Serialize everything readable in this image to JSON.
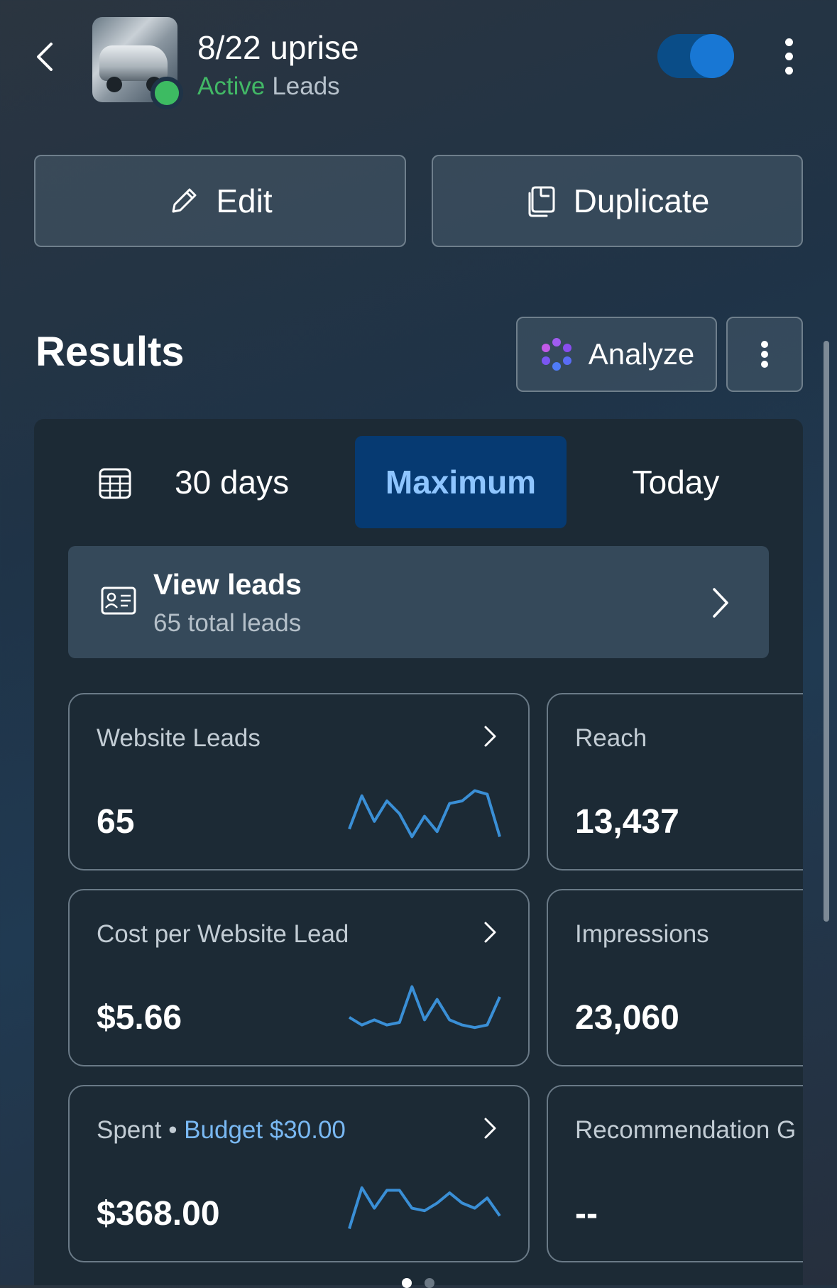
{
  "header": {
    "title": "8/22 uprise",
    "status": "Active",
    "objective": "Leads",
    "back_icon": "chevron-left-icon",
    "more_icon": "more-vertical-icon"
  },
  "actions": {
    "edit_label": "Edit",
    "duplicate_label": "Duplicate"
  },
  "results": {
    "heading": "Results",
    "analyze_label": "Analyze"
  },
  "date_tabs": {
    "tab_30": "30 days",
    "tab_max": "Maximum",
    "tab_today": "Today",
    "selected": "Maximum"
  },
  "view_leads": {
    "title": "View leads",
    "subtitle": "65 total leads"
  },
  "metrics": {
    "website_leads": {
      "label": "Website Leads",
      "value": "65",
      "trend": [
        0.2,
        0.85,
        0.35,
        0.75,
        0.5,
        0.05,
        0.45,
        0.15,
        0.7,
        0.75,
        0.95,
        0.88,
        0.05
      ]
    },
    "reach": {
      "label": "Reach",
      "value": "13,437"
    },
    "cost_per_lead": {
      "label": "Cost per Website Lead",
      "value": "$5.66",
      "trend": [
        0.35,
        0.2,
        0.3,
        0.2,
        0.25,
        0.95,
        0.3,
        0.7,
        0.3,
        0.2,
        0.15,
        0.2,
        0.75
      ]
    },
    "impressions": {
      "label": "Impressions",
      "value": "23,060"
    },
    "spent": {
      "label": "Spent",
      "budget_label": "Budget $30.00",
      "value": "$368.00",
      "trend": [
        0.05,
        0.85,
        0.45,
        0.8,
        0.8,
        0.45,
        0.4,
        0.55,
        0.75,
        0.55,
        0.45,
        0.65,
        0.3
      ]
    },
    "recommendation": {
      "label": "Recommendation G",
      "value": "--"
    }
  },
  "colors": {
    "accent_blue": "#1877d4",
    "active_green": "#3dbb62",
    "spark_line": "#3a8fd6",
    "selected_tab_text": "#8ec5ff"
  }
}
